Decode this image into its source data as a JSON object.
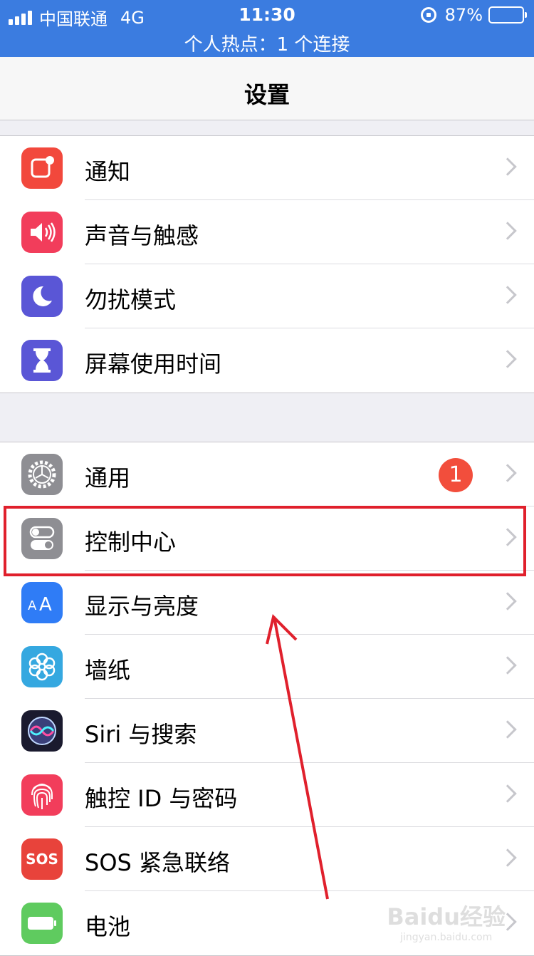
{
  "status_bar": {
    "carrier": "中国联通",
    "network": "4G",
    "time": "11:30",
    "battery": "87%",
    "battery_level": 0.87,
    "hotspot": "个人热点：1 个连接"
  },
  "nav": {
    "title": "设置"
  },
  "group1": [
    {
      "label": "通知",
      "icon": "notifications-icon",
      "color": "#f2483c"
    },
    {
      "label": "声音与触感",
      "icon": "speaker-icon",
      "color": "#f23d5b"
    },
    {
      "label": "勿扰模式",
      "icon": "moon-icon",
      "color": "#5a56d6"
    },
    {
      "label": "屏幕使用时间",
      "icon": "hourglass-icon",
      "color": "#5a56d6"
    }
  ],
  "group2": [
    {
      "label": "通用",
      "icon": "gear-icon",
      "color": "#8e8e93",
      "badge": "1"
    },
    {
      "label": "控制中心",
      "icon": "toggles-icon",
      "color": "#8e8e93"
    },
    {
      "label": "显示与亮度",
      "icon": "text-size-icon",
      "color": "#2f7cf6"
    },
    {
      "label": "墙纸",
      "icon": "flower-icon",
      "color": "#35a8e0"
    },
    {
      "label": "Siri 与搜索",
      "icon": "siri-icon",
      "color": "#1a1a2e"
    },
    {
      "label": "触控 ID 与密码",
      "icon": "fingerprint-icon",
      "color": "#f23d5b"
    },
    {
      "label": "SOS 紧急联络",
      "icon": "sos-icon",
      "color": "#e8433b",
      "icon_text": "SOS"
    },
    {
      "label": "电池",
      "icon": "battery-icon",
      "color": "#5fcb5f"
    }
  ],
  "watermark": {
    "brand": "Baidu经验",
    "url": "jingyan.baidu.com"
  },
  "colors": {
    "status_bar": "#3b7ce0",
    "highlight": "#e0202c",
    "badge": "#f24e3c"
  }
}
